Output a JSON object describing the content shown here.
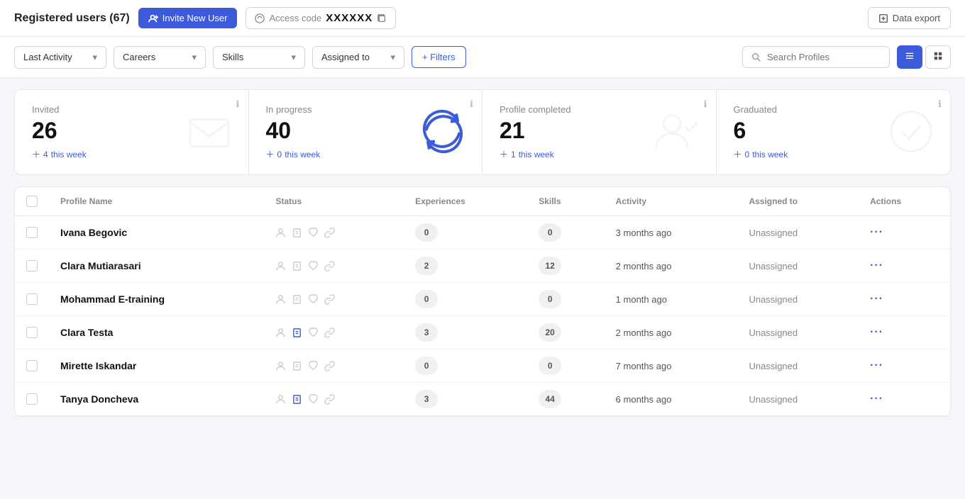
{
  "header": {
    "title": "Registered users (67)",
    "invite_btn": "Invite New User",
    "access_code_label": "Access code",
    "access_code_value": "XXXXXX",
    "data_export_btn": "Data export"
  },
  "filters": {
    "last_activity": "Last Activity",
    "careers": "Careers",
    "skills": "Skills",
    "assigned_to": "Assigned to",
    "filters_btn": "+ Filters",
    "search_placeholder": "Search Profiles"
  },
  "stats": [
    {
      "label": "Invited",
      "number": "26",
      "week_count": "4",
      "week_label": "this week"
    },
    {
      "label": "In progress",
      "number": "40",
      "week_count": "0",
      "week_label": "this week"
    },
    {
      "label": "Profile completed",
      "number": "21",
      "week_count": "1",
      "week_label": "this week"
    },
    {
      "label": "Graduated",
      "number": "6",
      "week_count": "0",
      "week_label": "this week"
    }
  ],
  "table": {
    "columns": [
      "Profile Name",
      "Status",
      "Experiences",
      "Skills",
      "Activity",
      "Assigned to",
      "Actions"
    ],
    "rows": [
      {
        "name": "Ivana Begovic",
        "experiences": "0",
        "skills": "0",
        "activity": "3 months ago",
        "assigned": "Unassigned"
      },
      {
        "name": "Clara Mutiarasari",
        "experiences": "2",
        "skills": "12",
        "activity": "2 months ago",
        "assigned": "Unassigned"
      },
      {
        "name": "Mohammad E-training",
        "experiences": "0",
        "skills": "0",
        "activity": "1 month ago",
        "assigned": "Unassigned"
      },
      {
        "name": "Clara Testa",
        "experiences": "3",
        "skills": "20",
        "activity": "2 months ago",
        "assigned": "Unassigned"
      },
      {
        "name": "Mirette Iskandar",
        "experiences": "0",
        "skills": "0",
        "activity": "7 months ago",
        "assigned": "Unassigned"
      },
      {
        "name": "Tanya Doncheva",
        "experiences": "3",
        "skills": "44",
        "activity": "6 months ago",
        "assigned": "Unassigned"
      }
    ]
  }
}
